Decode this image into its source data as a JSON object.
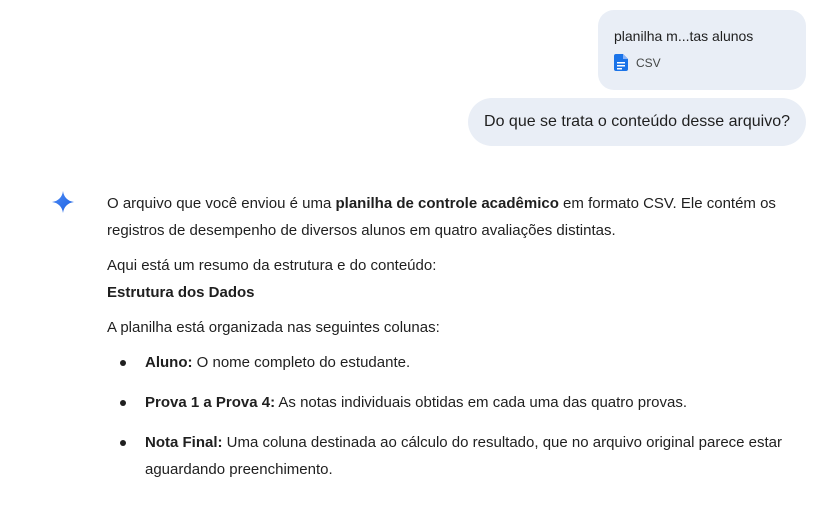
{
  "attachment": {
    "file_name": "planilha m...tas alunos",
    "file_type": "CSV",
    "icon": "google-doc-file-icon",
    "icon_color": "#1a73e8"
  },
  "user_message": "Do que se trata o conteúdo desse arquivo?",
  "response": {
    "icon": "gemini-sparkle-icon",
    "intro_prefix": "O arquivo que você enviou é uma ",
    "intro_bold": "planilha de controle acadêmico",
    "intro_suffix": " em formato CSV. Ele contém os registros de desempenho de diversos alunos em quatro avaliações distintas.",
    "summary_line": "Aqui está um resumo da estrutura e do conteúdo:",
    "section_heading": "Estrutura dos Dados",
    "section_intro": "A planilha está organizada nas seguintes colunas:",
    "columns": [
      {
        "label": "Aluno:",
        "text": " O nome completo do estudante."
      },
      {
        "label": "Prova 1 a Prova 4:",
        "text": " As notas individuais obtidas em cada uma das quatro provas."
      },
      {
        "label": "Nota Final:",
        "text": " Uma coluna destinada ao cálculo do resultado, que no arquivo original parece estar aguardando preenchimento."
      }
    ]
  },
  "colors": {
    "bubble_bg": "#e9eef6",
    "text": "#1f1f1f",
    "accent_blue": "#1a73e8"
  }
}
